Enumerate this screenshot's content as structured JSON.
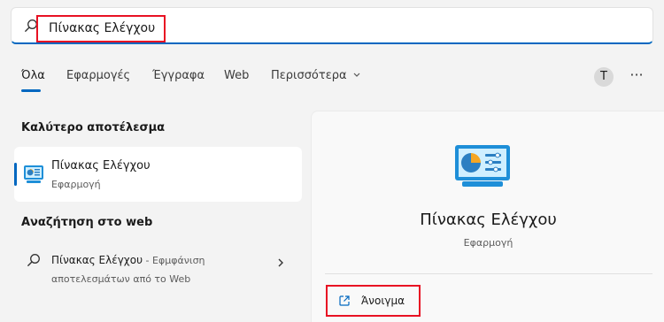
{
  "search": {
    "value": "Πίνακας Ελέγχου"
  },
  "tabs": [
    {
      "label": "Όλα"
    },
    {
      "label": "Εφαρμογές"
    },
    {
      "label": "Έγγραφα"
    },
    {
      "label": "Web"
    },
    {
      "label": "Περισσότερα"
    }
  ],
  "header": {
    "avatar_initial": "T",
    "more_label": "···"
  },
  "best_match": {
    "heading": "Καλύτερο αποτέλεσμα",
    "name": "Πίνακας Ελέγχου",
    "type": "Εφαρμογή"
  },
  "web_search": {
    "heading": "Αναζήτηση στο web",
    "query": "Πίνακας Ελέγχου",
    "suffix": " - Εφμφάνιση αποτελεσμάτων από το Web"
  },
  "details": {
    "name": "Πίνακας Ελέγχου",
    "type": "Εφαρμογή",
    "actions": [
      {
        "label": "Άνοιγμα",
        "icon": "open-external-icon"
      }
    ]
  },
  "colors": {
    "accent": "#0067c0",
    "highlight": "#e81123"
  }
}
